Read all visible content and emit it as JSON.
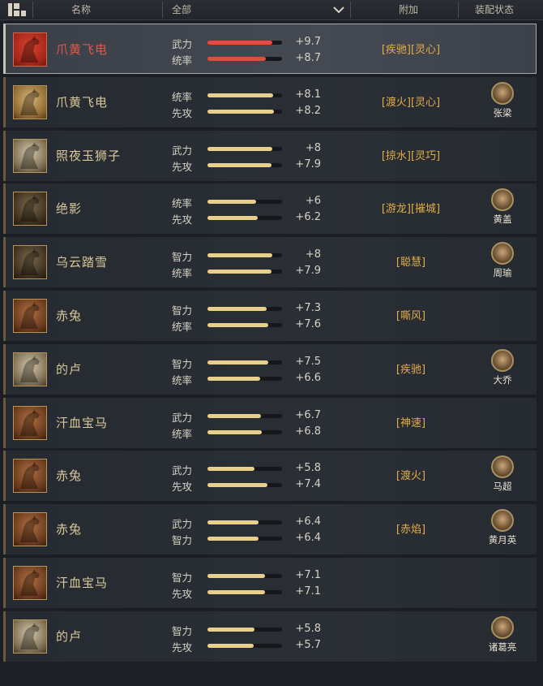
{
  "header": {
    "col_name": "名称",
    "col_filter": "全部",
    "col_bonus": "附加",
    "col_equip": "装配状态"
  },
  "rows": [
    {
      "name": "爪黄飞电",
      "portrait": "horse-portrait-red",
      "s1": "武力",
      "b1": 0.87,
      "v1": "+9.7",
      "s2": "统率",
      "b2": 0.78,
      "v2": "+8.7",
      "tags": "[疾驰][灵心]",
      "equip": "",
      "selected": true
    },
    {
      "name": "爪黄飞电",
      "portrait": "horse-portrait-gold",
      "s1": "统率",
      "b1": 0.88,
      "v1": "+8.1",
      "s2": "先攻",
      "b2": 0.89,
      "v2": "+8.2",
      "tags": "[渡火][灵心]",
      "equip": "张梁"
    },
    {
      "name": "照夜玉狮子",
      "portrait": "horse-portrait-white",
      "s1": "武力",
      "b1": 0.87,
      "v1": "+8",
      "s2": "先攻",
      "b2": 0.86,
      "v2": "+7.9",
      "tags": "[掠水][灵巧]",
      "equip": ""
    },
    {
      "name": "绝影",
      "portrait": "horse-portrait-dark",
      "s1": "统率",
      "b1": 0.65,
      "v1": "+6",
      "s2": "先攻",
      "b2": 0.67,
      "v2": "+6.2",
      "tags": "[游龙][摧城]",
      "equip": "黄盖"
    },
    {
      "name": "乌云踏雪",
      "portrait": "horse-portrait-dark",
      "s1": "智力",
      "b1": 0.87,
      "v1": "+8",
      "s2": "统率",
      "b2": 0.86,
      "v2": "+7.9",
      "tags": "[聪慧]",
      "equip": "周瑜"
    },
    {
      "name": "赤兔",
      "portrait": "horse-portrait-brown",
      "s1": "智力",
      "b1": 0.79,
      "v1": "+7.3",
      "s2": "统率",
      "b2": 0.82,
      "v2": "+7.6",
      "tags": "[嘶风]",
      "equip": ""
    },
    {
      "name": "的卢",
      "portrait": "horse-portrait-white",
      "s1": "智力",
      "b1": 0.81,
      "v1": "+7.5",
      "s2": "统率",
      "b2": 0.71,
      "v2": "+6.6",
      "tags": "[疾驰]",
      "equip": "大乔"
    },
    {
      "name": "汗血宝马",
      "portrait": "horse-portrait-brown",
      "s1": "武力",
      "b1": 0.72,
      "v1": "+6.7",
      "s2": "统率",
      "b2": 0.73,
      "v2": "+6.8",
      "tags": "[神速]",
      "equip": ""
    },
    {
      "name": "赤兔",
      "portrait": "horse-portrait-brown",
      "s1": "武力",
      "b1": 0.63,
      "v1": "+5.8",
      "s2": "先攻",
      "b2": 0.8,
      "v2": "+7.4",
      "tags": "[渡火]",
      "equip": "马超"
    },
    {
      "name": "赤兔",
      "portrait": "horse-portrait-brown",
      "s1": "武力",
      "b1": 0.69,
      "v1": "+6.4",
      "s2": "智力",
      "b2": 0.69,
      "v2": "+6.4",
      "tags": "[赤焰]",
      "equip": "黄月英"
    },
    {
      "name": "汗血宝马",
      "portrait": "horse-portrait-brown",
      "s1": "智力",
      "b1": 0.77,
      "v1": "+7.1",
      "s2": "先攻",
      "b2": 0.77,
      "v2": "+7.1",
      "tags": "",
      "equip": ""
    },
    {
      "name": "的卢",
      "portrait": "horse-portrait-white",
      "s1": "智力",
      "b1": 0.63,
      "v1": "+5.8",
      "s2": "先攻",
      "b2": 0.62,
      "v2": "+5.7",
      "tags": "",
      "equip": "诸葛亮"
    }
  ]
}
